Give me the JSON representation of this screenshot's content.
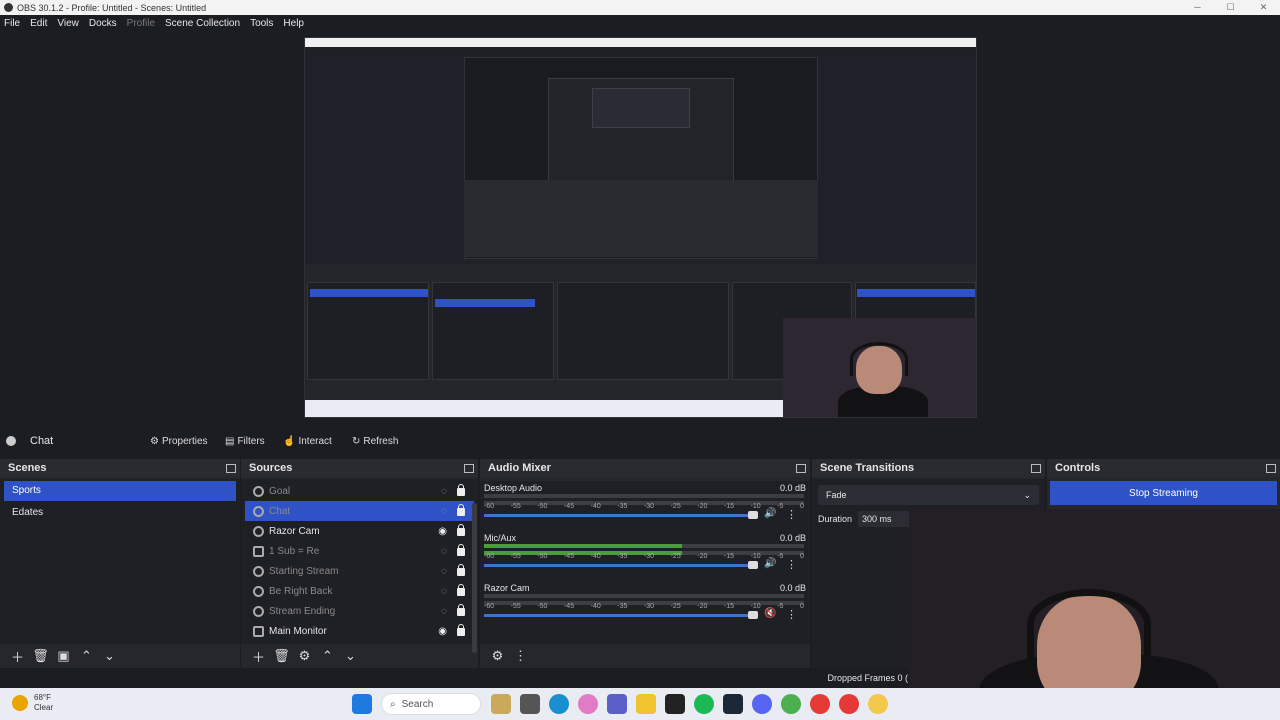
{
  "window": {
    "title": "OBS 30.1.2 - Profile: Untitled - Scenes: Untitled"
  },
  "menu": [
    "File",
    "Edit",
    "View",
    "Docks",
    "Profile",
    "Scene Collection",
    "Tools",
    "Help"
  ],
  "context_bar": {
    "source_name": "Chat",
    "properties": "Properties",
    "filters": "Filters",
    "interact": "Interact",
    "refresh": "Refresh"
  },
  "scenes": {
    "title": "Scenes",
    "items": [
      "Sports",
      "Edates"
    ],
    "selected": "Sports"
  },
  "sources": {
    "title": "Sources",
    "items": [
      {
        "label": "Goal",
        "visible": false
      },
      {
        "label": "Chat",
        "visible": false,
        "selected": true
      },
      {
        "label": "Razor Cam",
        "visible": true
      },
      {
        "label": "1 Sub = Re",
        "visible": false
      },
      {
        "label": "Starting Stream",
        "visible": false
      },
      {
        "label": "Be Right Back",
        "visible": false
      },
      {
        "label": "Stream Ending",
        "visible": false
      },
      {
        "label": "Main Monitor",
        "visible": true
      }
    ]
  },
  "mixer": {
    "title": "Audio Mixer",
    "ticks": [
      "-60",
      "-55",
      "-50",
      "-45",
      "-40",
      "-35",
      "-30",
      "-25",
      "-20",
      "-15",
      "-10",
      "-5",
      "0"
    ],
    "channels": [
      {
        "name": "Desktop Audio",
        "db": "0.0 dB",
        "level": 0.0,
        "muted": false
      },
      {
        "name": "Mic/Aux",
        "db": "0.0 dB",
        "level": 0.62,
        "muted": false
      },
      {
        "name": "Razor Cam",
        "db": "0.0 dB",
        "level": 0.0,
        "muted": true
      }
    ]
  },
  "transitions": {
    "title": "Scene Transitions",
    "selected": "Fade",
    "duration_label": "Duration",
    "duration_value": "300 ms"
  },
  "controls": {
    "title": "Controls",
    "stop_streaming": "Stop Streaming"
  },
  "status": {
    "dropped": "Dropped Frames 0 ("
  },
  "taskbar": {
    "weather_temp": "68°F",
    "weather_cond": "Clear",
    "search": "Search"
  },
  "colors": {
    "accent": "#2f52c7",
    "panel": "#26272d",
    "bg": "#1c1d22"
  }
}
